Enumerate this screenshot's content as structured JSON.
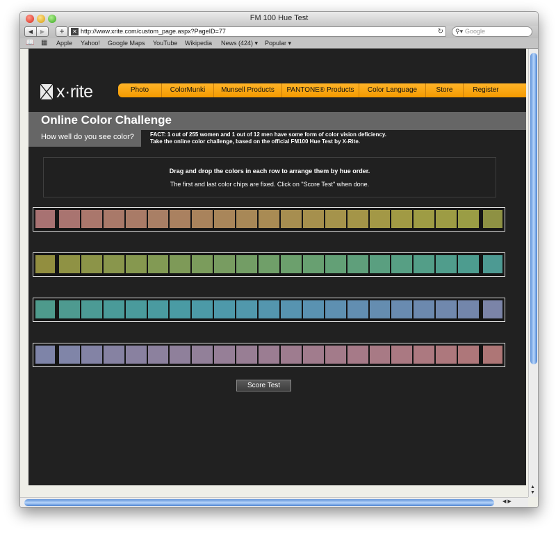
{
  "window": {
    "title": "FM 100 Hue Test"
  },
  "toolbar": {
    "back_glyph": "◀",
    "forward_glyph": "▶",
    "add_glyph": "+",
    "url": "http://www.xrite.com/custom_page.aspx?PageID=77",
    "reload_glyph": "↻",
    "search_placeholder": "Google"
  },
  "bookmarks": [
    "Apple",
    "Yahoo!",
    "Google Maps",
    "YouTube",
    "Wikipedia",
    "News (424) ▾",
    "Popular ▾"
  ],
  "logo": {
    "text": "x·rite"
  },
  "nav": [
    "Photo",
    "ColorMunki",
    "Munsell Products",
    "PANTONE® Products",
    "Color Language",
    "Store",
    "Register"
  ],
  "header": {
    "title": "Online Color Challenge",
    "subtitle": "How well do you see color?",
    "fact_1": "FACT: 1 out of 255 women and 1 out of 12 men have some form of color vision deficiency.",
    "fact_2": "Take the online color challenge, based on the official FM100 Hue Test by X-Rite."
  },
  "instructions": {
    "line_1": "Drag and drop the colors in each row to arrange them by hue order.",
    "line_2": "The first and last color chips are fixed. Click on \"Score Test\" when done."
  },
  "chip_rows": [
    [
      "#a87272",
      "#a97470",
      "#aa776c",
      "#a97969",
      "#a97b67",
      "#a97f65",
      "#aa8160",
      "#a9835c",
      "#a9865a",
      "#a88857",
      "#a98b54",
      "#a78e50",
      "#a6904d",
      "#a5934b",
      "#a49548",
      "#a39846",
      "#a19a44",
      "#9e9c44",
      "#9d9c44",
      "#9a9d45",
      "#8e9143"
    ],
    [
      "#928e3f",
      "#8f9244",
      "#8c9448",
      "#89964c",
      "#86984f",
      "#829a54",
      "#7e9a58",
      "#7b9c5c",
      "#789c61",
      "#739d65",
      "#709f69",
      "#6ca06d",
      "#68a071",
      "#63a076",
      "#5f9f7b",
      "#5a9f80",
      "#579f84",
      "#539e88",
      "#509d8c",
      "#4d9c8f",
      "#4d9a93"
    ],
    [
      "#4e9a8c",
      "#4e9a90",
      "#4c9b95",
      "#4a9b99",
      "#4a9b9c",
      "#4a9ba0",
      "#4a9ba4",
      "#4c9aa7",
      "#4e99aa",
      "#5198ac",
      "#5496ae",
      "#5794b0",
      "#5a92b1",
      "#5e90b1",
      "#628eb1",
      "#658db0",
      "#698bb0",
      "#6c89ae",
      "#7088ad",
      "#7386ab",
      "#7b84a8"
    ],
    [
      "#7e84a8",
      "#8085a8",
      "#8383a5",
      "#8682a2",
      "#8981a0",
      "#8c819e",
      "#8f809b",
      "#928099",
      "#967f97",
      "#987e94",
      "#9b7d92",
      "#9e7c8f",
      "#a17c8d",
      "#a37b8a",
      "#a67a88",
      "#a87a85",
      "#aa7982",
      "#ac7980",
      "#ad787d",
      "#ae777a",
      "#ae7676"
    ]
  ],
  "score_button": "Score Test"
}
